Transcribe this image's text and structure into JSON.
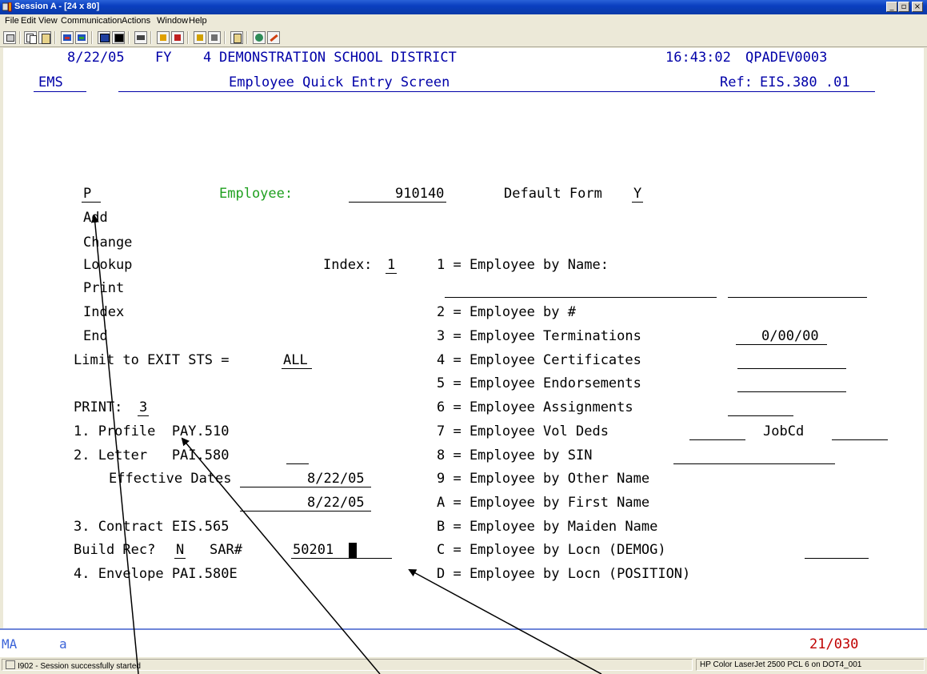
{
  "window": {
    "title": "Session A - [24 x 80]",
    "controls": {
      "minimize": "_",
      "maximize": "▫",
      "close": "×"
    }
  },
  "menu": [
    "File",
    "Edit",
    "View",
    "Communication",
    "Actions",
    "Window",
    "Help"
  ],
  "toolbar_icons": [
    "display-icon",
    "copy-icon",
    "paste-icon",
    "send-icon",
    "receive-icon",
    "screen-icon",
    "screen2-icon",
    "macro-icon",
    "record-icon",
    "playback-icon",
    "color1-icon",
    "color2-icon",
    "notes-icon",
    "globe-icon",
    "edit-icon"
  ],
  "header": {
    "date": "8/22/05",
    "fy_label": "FY",
    "fy_value": "4",
    "district": "DEMONSTRATION SCHOOL DISTRICT",
    "time": "16:43:02",
    "device": "QPADEV0003",
    "system": "EMS",
    "screen_title": "Employee Quick Entry Screen",
    "ref_label": "Ref:",
    "ref_value": "EIS.380 .01"
  },
  "form": {
    "action_value": "P",
    "employee_label": "Employee:",
    "employee_value": "910140",
    "default_form_label": "Default Form",
    "default_form_value": "Y",
    "actions": [
      "Add",
      "Change",
      "Lookup",
      "Print",
      "Index",
      "End"
    ],
    "index_label": "Index:",
    "index_value": "1",
    "limit_label": "Limit to EXIT STS =",
    "limit_value": "ALL",
    "print_label": "PRINT:",
    "print_value": "3",
    "opt1": "1. Profile  PAY.510",
    "opt2": "2. Letter   PAI.580",
    "effective_label": "Effective Dates",
    "effective_from": "8/22/05",
    "effective_to": "8/22/05",
    "opt3": "3. Contract EIS.565",
    "build_label": "Build Rec?",
    "build_value": "N",
    "sar_label": "SAR#",
    "sar_value": "50201",
    "opt4": "4. Envelope PAI.580E"
  },
  "index_options": [
    "1 = Employee by Name:",
    "2 = Employee by #",
    "3 = Employee Terminations",
    "4 = Employee Certificates",
    "5 = Employee Endorsements",
    "6 = Employee Assignments",
    "7 = Employee Vol Deds",
    "8 = Employee by SIN",
    "9 = Employee by Other Name",
    "A = Employee by First Name",
    "B = Employee by Maiden Name",
    "C = Employee by Locn (DEMOG)",
    "D = Employee by Locn (POSITION)"
  ],
  "terminations_date": "0/00/00",
  "jobcd_label": "JobCd",
  "oia": {
    "mode": "MA",
    "indicator": "a",
    "cursor_pos": "21/030"
  },
  "statusbar": {
    "message": "I902 - Session successfully started",
    "printer": "HP Color LaserJet 2500 PCL 6 on DOT4_001"
  }
}
